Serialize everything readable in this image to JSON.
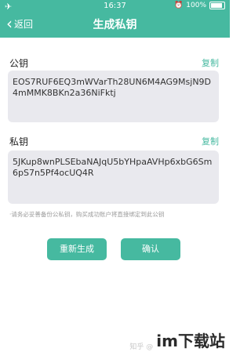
{
  "status": {
    "left_icon": "airplane-icon",
    "time": "16:37",
    "battery": "100%"
  },
  "navbar": {
    "back_label": "返回",
    "title": "生成私钥"
  },
  "public_key": {
    "label": "公钥",
    "copy_label": "复制",
    "value": "EOS7RUF6EQ3mWVarTh28UN6M4AG9MsjN9D4mMMK8BKn2a36NiFktj"
  },
  "private_key": {
    "label": "私钥",
    "copy_label": "复制",
    "value": "5JKup8wnPLSEbaNAJqU5bYHpaAVHp6xbG6Sm6pS7n5Pf4ocUQ4R"
  },
  "note": "·请务必妥善备份公私钥，购买成功账户将直接绑定到此公钥",
  "buttons": {
    "regenerate": "重新生成",
    "confirm": "确认"
  },
  "watermark": {
    "text": "知乎 @",
    "logo": "im下载站"
  },
  "colors": {
    "accent": "#46b9a0"
  }
}
